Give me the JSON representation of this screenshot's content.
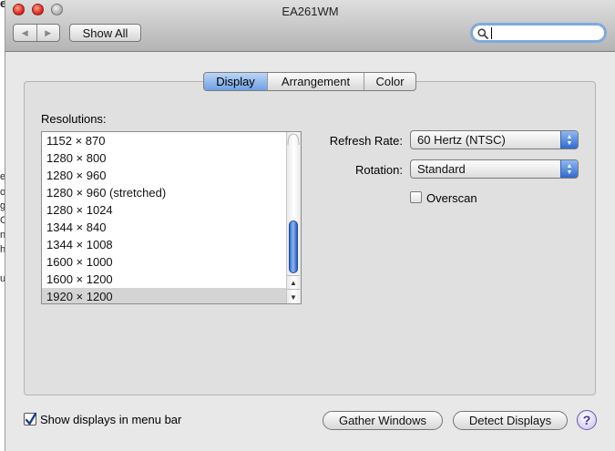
{
  "window": {
    "title": "EA261WM",
    "show_all_label": "Show All",
    "nav_back_glyph": "◀",
    "nav_forward_glyph": "▶",
    "search": {
      "value": "",
      "placeholder": ""
    }
  },
  "tabs": [
    {
      "label": "Display",
      "selected": true
    },
    {
      "label": "Arrangement",
      "selected": false
    },
    {
      "label": "Color",
      "selected": false
    }
  ],
  "resolutions": {
    "label": "Resolutions:",
    "items": [
      "1152 × 870",
      "1280 × 800",
      "1280 × 960",
      "1280 × 960 (stretched)",
      "1280 × 1024",
      "1344 × 840",
      "1344 × 1008",
      "1600 × 1000",
      "1600 × 1200",
      "1920 × 1200"
    ],
    "selected": "1920 × 1200"
  },
  "refresh_rate": {
    "label": "Refresh Rate:",
    "value": "60 Hertz (NTSC)"
  },
  "rotation": {
    "label": "Rotation:",
    "value": "Standard"
  },
  "overscan": {
    "label": "Overscan",
    "checked": false
  },
  "bottom": {
    "menubar_label": "Show displays in menu bar",
    "menubar_checked": true,
    "gather_label": "Gather Windows",
    "detect_label": "Detect Displays",
    "help_label": "?"
  },
  "background_fragments": [
    "e",
    "e",
    "o",
    "g",
    "O",
    "n",
    "h",
    "u"
  ],
  "colors": {
    "accent": "#3b7be0",
    "selection": "#d4d4d4",
    "help": "#4b2fa0"
  }
}
